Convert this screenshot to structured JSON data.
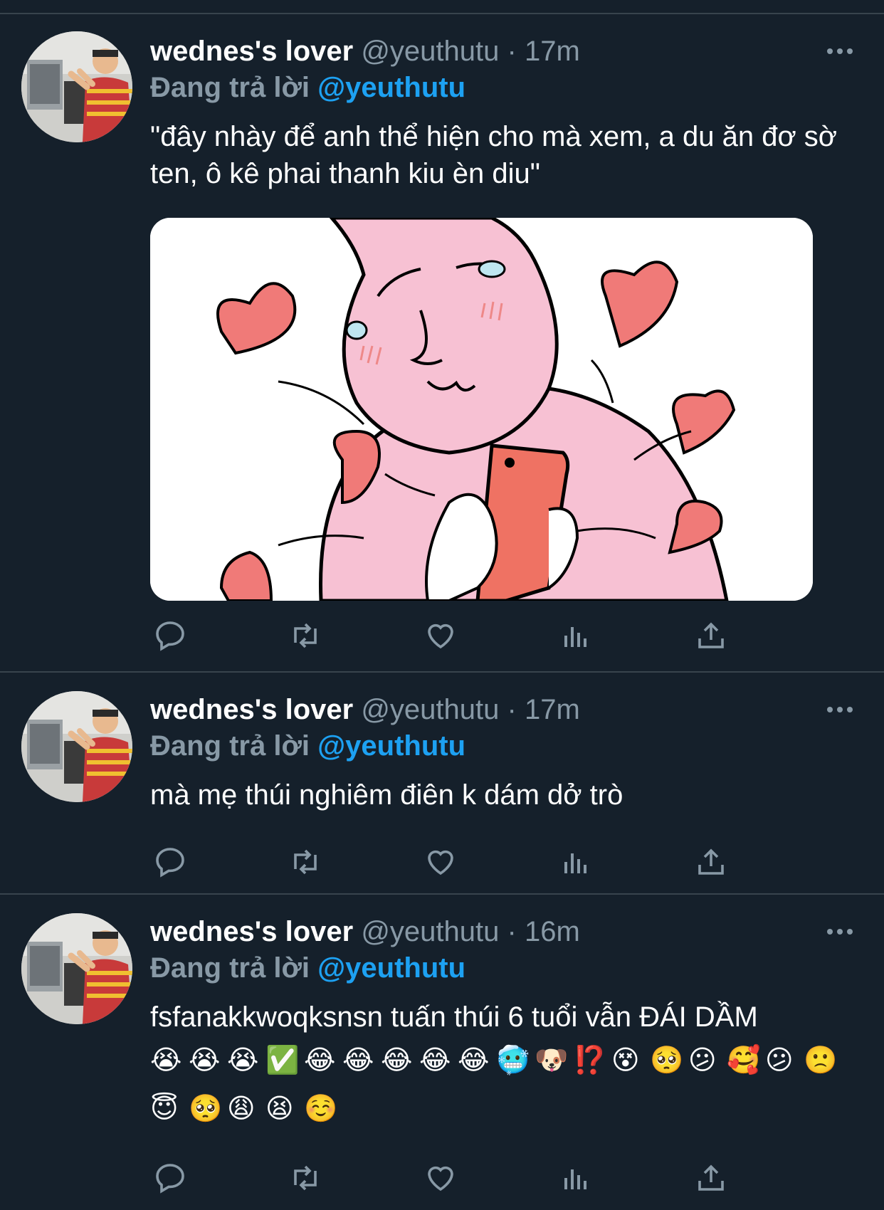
{
  "colors": {
    "background": "#15202b",
    "divider": "#38444d",
    "secondary_text": "#8899a6",
    "link": "#1da1f2"
  },
  "tweets": [
    {
      "name": "wednes's lover",
      "handle": "@yeuthutu",
      "separator": "·",
      "time": "17m",
      "reply_label": "Đang trả lời",
      "reply_handle": "@yeuthutu",
      "text": "\"đây nhày để anh thể hiện cho mà xem, a du ăn đơ sờ ten, ô kê phai thanh kiu èn diu\"",
      "has_image": true,
      "image_icon": "pink-blob-holding-phone-with-hearts-illustration"
    },
    {
      "name": "wednes's lover",
      "handle": "@yeuthutu",
      "separator": "·",
      "time": "17m",
      "reply_label": "Đang trả lời",
      "reply_handle": "@yeuthutu",
      "text": "mà mẹ thúi nghiêm điên k dám dở trò"
    },
    {
      "name": "wednes's lover",
      "handle": "@yeuthutu",
      "separator": "·",
      "time": "16m",
      "reply_label": "Đang trả lời",
      "reply_handle": "@yeuthutu",
      "text": "fsfanakkwoqksnsn tuấn thúi 6 tuổi vẫn ĐÁI DẦM",
      "emoji_rows": [
        [
          "😭",
          "😭",
          "😭",
          "✅",
          "😂",
          "😂",
          "😂",
          "😂",
          "😂",
          "🥶",
          "🐶",
          "⁉️",
          "😵",
          "🥺",
          "😕",
          "🥰",
          "😕",
          "🙁"
        ],
        [
          "😇",
          "🥺",
          "😩",
          "😫",
          "☺️"
        ]
      ]
    }
  ],
  "action_icons": [
    "reply-icon",
    "retweet-icon",
    "like-icon",
    "analytics-icon",
    "share-icon"
  ]
}
